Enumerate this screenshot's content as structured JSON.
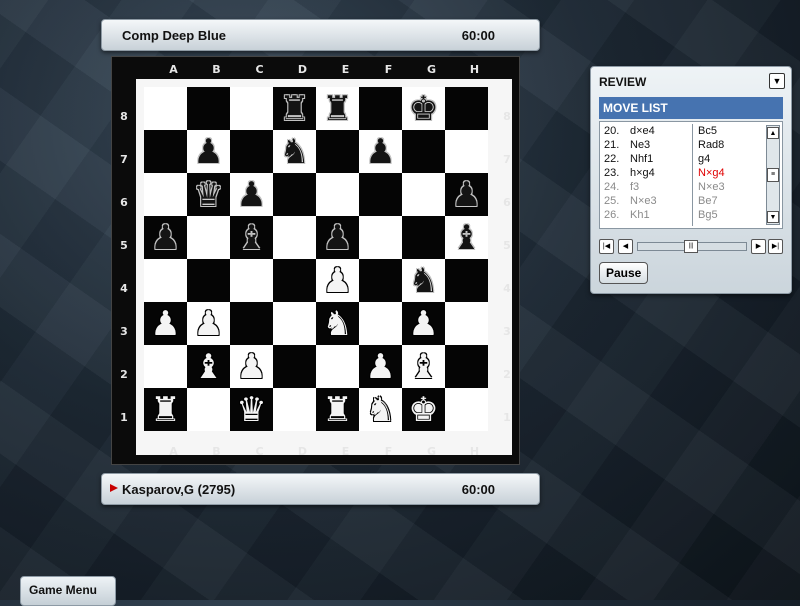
{
  "top_player": {
    "name": "Comp Deep Blue",
    "clock": "60:00"
  },
  "bottom_player": {
    "name": "Kasparov,G (2795)",
    "clock": "60:00",
    "to_move": true
  },
  "board": {
    "files": [
      "A",
      "B",
      "C",
      "D",
      "E",
      "F",
      "G",
      "H"
    ],
    "ranks": [
      "8",
      "7",
      "6",
      "5",
      "4",
      "3",
      "2",
      "1"
    ],
    "position": [
      [
        "",
        "",
        "",
        "bR",
        "bR",
        "",
        "bK",
        ""
      ],
      [
        "",
        "bP",
        "",
        "bN",
        "",
        "bP",
        "",
        ""
      ],
      [
        "",
        "bQ",
        "bP",
        "",
        "",
        "",
        "",
        "bP"
      ],
      [
        "bP",
        "",
        "bB",
        "",
        "bP",
        "",
        "",
        "bB"
      ],
      [
        "",
        "",
        "",
        "",
        "wP",
        "",
        "bN",
        ""
      ],
      [
        "wP",
        "wP",
        "",
        "",
        "wN",
        "",
        "wP",
        ""
      ],
      [
        "",
        "wB",
        "wP",
        "",
        "",
        "wP",
        "wB",
        ""
      ],
      [
        "wR",
        "",
        "wQ",
        "",
        "wR",
        "wN",
        "wK",
        ""
      ]
    ],
    "colors": {
      "light": "#ffffff",
      "dark": "#050505"
    }
  },
  "review": {
    "title": "REVIEW",
    "move_list_title": "MOVE LIST",
    "moves": [
      {
        "num": "20.",
        "white": "d×e4",
        "black": "Bc5",
        "state": "played"
      },
      {
        "num": "21.",
        "white": "Ne3",
        "black": "Rad8",
        "state": "played"
      },
      {
        "num": "22.",
        "white": "Nhf1",
        "black": "g4",
        "state": "played"
      },
      {
        "num": "23.",
        "white": "h×g4",
        "black": "N×g4",
        "state": "current"
      },
      {
        "num": "24.",
        "white": "f3",
        "black": "N×e3",
        "state": "future"
      },
      {
        "num": "25.",
        "white": "N×e3",
        "black": "Be7",
        "state": "future"
      },
      {
        "num": "26.",
        "white": "Kh1",
        "black": "Bg5",
        "state": "future"
      }
    ],
    "pause_label": "Pause",
    "accent_color": "#4673b0",
    "current_move_color": "#e00000"
  },
  "game_menu_label": "Game Menu"
}
